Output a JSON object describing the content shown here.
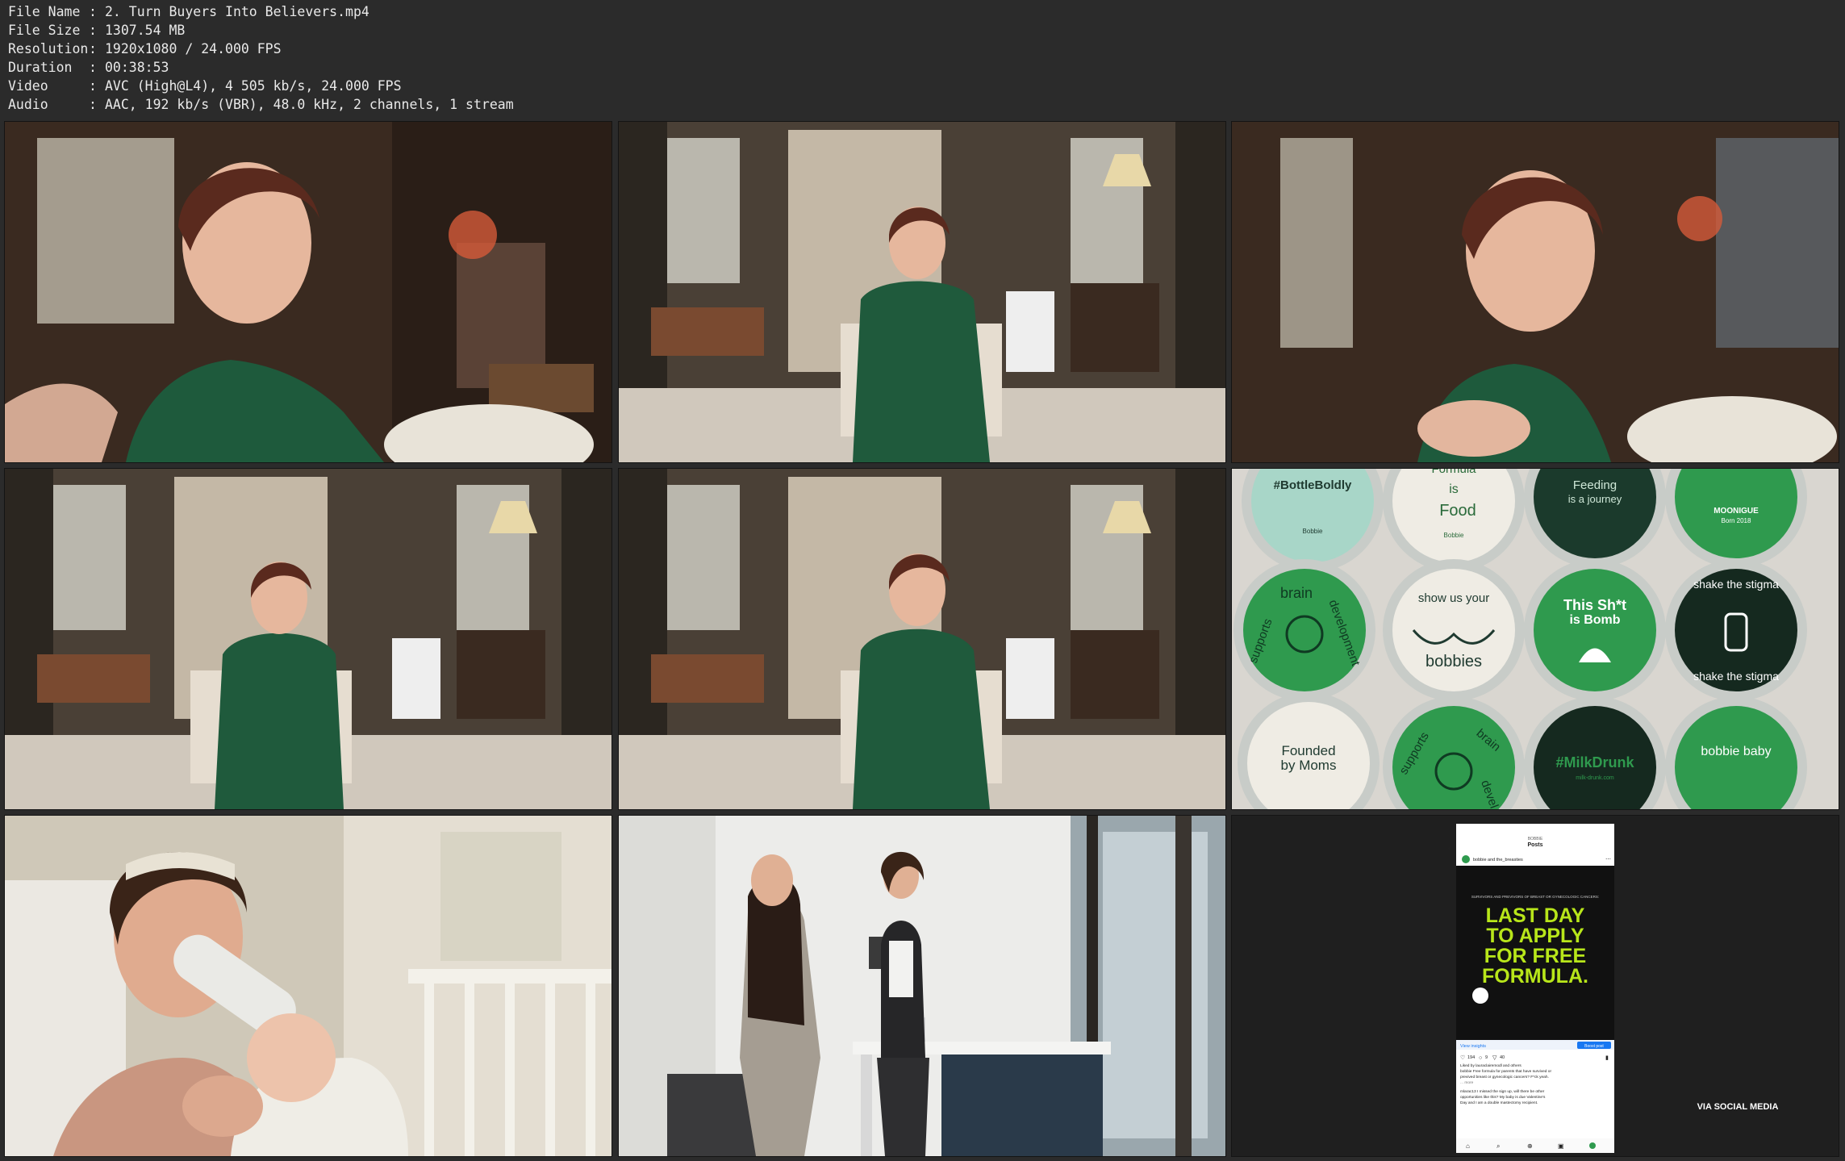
{
  "file_info": [
    {
      "key": "File Name",
      "value": "2. Turn Buyers Into Believers.mp4"
    },
    {
      "key": "File Size",
      "value": "1307.54 MB"
    },
    {
      "key": "Resolution",
      "value": "1920x1080 / 24.000 FPS"
    },
    {
      "key": "Duration",
      "value": "00:38:53"
    },
    {
      "key": "Video",
      "value": "AVC (High@L4), 4 505 kb/s, 24.000 FPS"
    },
    {
      "key": "Audio",
      "value": "AAC, 192 kb/s (VBR), 48.0 kHz, 2 channels, 1 stream"
    }
  ],
  "separator": ":",
  "lids": {
    "r1": [
      "#BottleBoldly",
      "Formula",
      "is",
      "Food",
      "Feeding",
      "is a journey",
      "MOONIGUE",
      "Born 2018"
    ],
    "r2": [
      "brain",
      "development",
      "supports",
      "show us your",
      "bobbies",
      "This Sh*t",
      "is Bomb",
      "shake the stigma",
      "shake the stigma"
    ],
    "r3": [
      "Founded",
      "by Moms",
      "supports",
      "brain",
      "devel",
      "#MilkDrunk",
      "milk-drunk.com",
      "bobbie baby"
    ],
    "brand": "Bobbie"
  },
  "instagram": {
    "account": "BOBBIE",
    "header": "Posts",
    "user": "bobbie and the_breasties",
    "caption_small": "SURVIVORS AND PREVIVORS OF BREAST OR GYNECOLOGIC CANCERS:",
    "headline": [
      "LAST DAY",
      "TO APPLY",
      "FOR FREE",
      "FORMULA."
    ],
    "insights": "View insights",
    "boost": "Boost post",
    "likes": "194",
    "comments": "9",
    "shares": "40",
    "liked_by": "Liked by lauraclairemodl and others",
    "caption": "bobbie Free formula for parents that have survived or",
    "caption2": "previved breast or gynecologic cancers? F*ck yeah.",
    "more": "... more",
    "comment": "mlarac13 I missed the sign up, will there be other",
    "comment2": "opportunities like this? My baby is due Valentine's",
    "comment3": "Day and I am a double mastectomy recipient."
  },
  "via_label": "VIA SOCIAL MEDIA"
}
